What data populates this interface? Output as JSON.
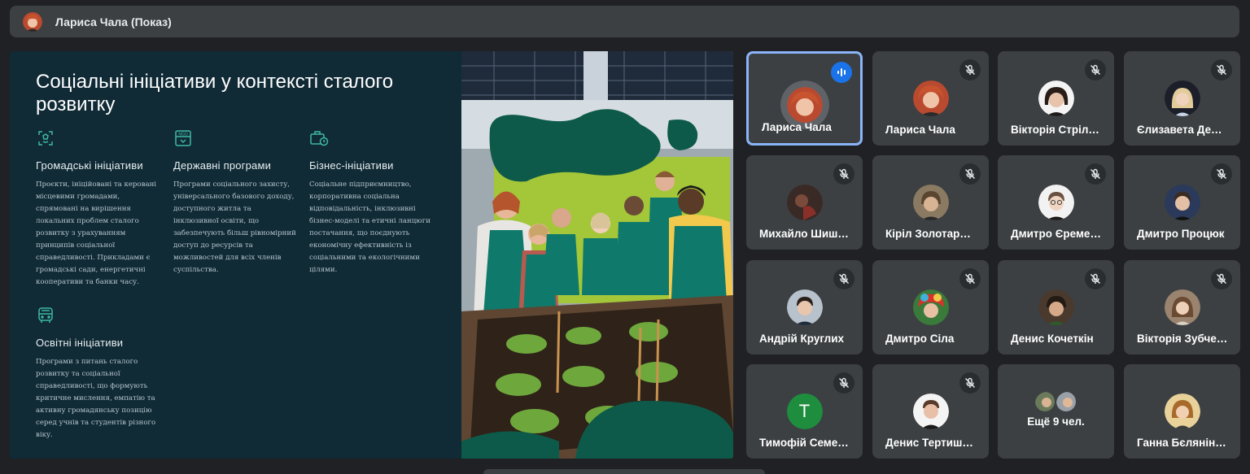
{
  "presenter_bar": {
    "title": "Лариса Чала (Показ)"
  },
  "slide": {
    "title": "Соціальні ініціативи у контексті сталого розвитку",
    "columns": [
      {
        "heading": "Громадські ініціативи",
        "icon": "recycle-icon",
        "text": "Проєкти, ініційовані та керовані місцевими громадами, спрямовані на вирішення локальних проблем сталого розвитку з урахуванням принципів соціальної справедливості. Прикладами є громадські сади, енергетичні кооперативи та банки часу."
      },
      {
        "heading": "Державні програми",
        "icon": "ngo-icon",
        "text": "Програми соціального захисту, універсального базового доходу, доступного житла та інклюзивної освіти, що забезпечують більш рівномірний доступ до ресурсів та можливостей для всіх членів суспільства."
      },
      {
        "heading": "Бізнес-ініціативи",
        "icon": "briefcase-clock-icon",
        "text": "Соціальне підприємництво, корпоративна соціальна відповідальність, інклюзивні бізнес-моделі та етичні ланцюги постачання, що поєднують економічну ефективність із соціальними та екологічними цілями."
      },
      {
        "heading": "Освітні ініціативи",
        "icon": "school-bus-icon",
        "text": "Програми з питань сталого розвитку та соціальної справедливості, що формують критичне мислення, емпатію та активну громадянську позицію серед учнів та студентів різного віку."
      }
    ]
  },
  "participants": [
    {
      "name": "Лариса Чала",
      "state": "speaking",
      "avatar_color": "#7b3f2a"
    },
    {
      "name": "Лариса Чала",
      "state": "muted",
      "avatar_color": "#7b3f2a"
    },
    {
      "name": "Вікторія Стрілецька",
      "state": "muted",
      "avatar_color": "#4a3a33"
    },
    {
      "name": "Єлизавета Демченко",
      "state": "muted",
      "avatar_color": "#c9b08a"
    },
    {
      "name": "Михайло Шишкін",
      "state": "muted",
      "avatar_color": "#2d2320"
    },
    {
      "name": "Кіріл Золотарьов",
      "state": "muted",
      "avatar_color": "#6b5a45"
    },
    {
      "name": "Дмитро Єременко",
      "state": "muted",
      "avatar_color": "#d9d3cc"
    },
    {
      "name": "Дмитро Процюк",
      "state": "muted",
      "avatar_color": "#2b3a5a"
    },
    {
      "name": "Андрій Круглих",
      "state": "muted",
      "avatar_color": "#8a7f78"
    },
    {
      "name": "Дмитро Сіла",
      "state": "muted",
      "avatar_color": "#c9302c"
    },
    {
      "name": "Денис Кочеткін",
      "state": "muted",
      "avatar_color": "#4a3a2e"
    },
    {
      "name": "Вікторія Зубченко",
      "state": "muted",
      "avatar_color": "#9a8470"
    },
    {
      "name": "Тимофій Семенюк",
      "state": "muted",
      "letter": "T",
      "avatar_color": "#1e8e3e"
    },
    {
      "name": "Денис Тертишний",
      "state": "muted",
      "avatar_color": "#d8c9bd"
    },
    {
      "name": "Ещё 9 чел.",
      "state": "more"
    },
    {
      "name": "Ганна Бєлянінова",
      "state": "none",
      "avatar_color": "#c99a58"
    }
  ]
}
